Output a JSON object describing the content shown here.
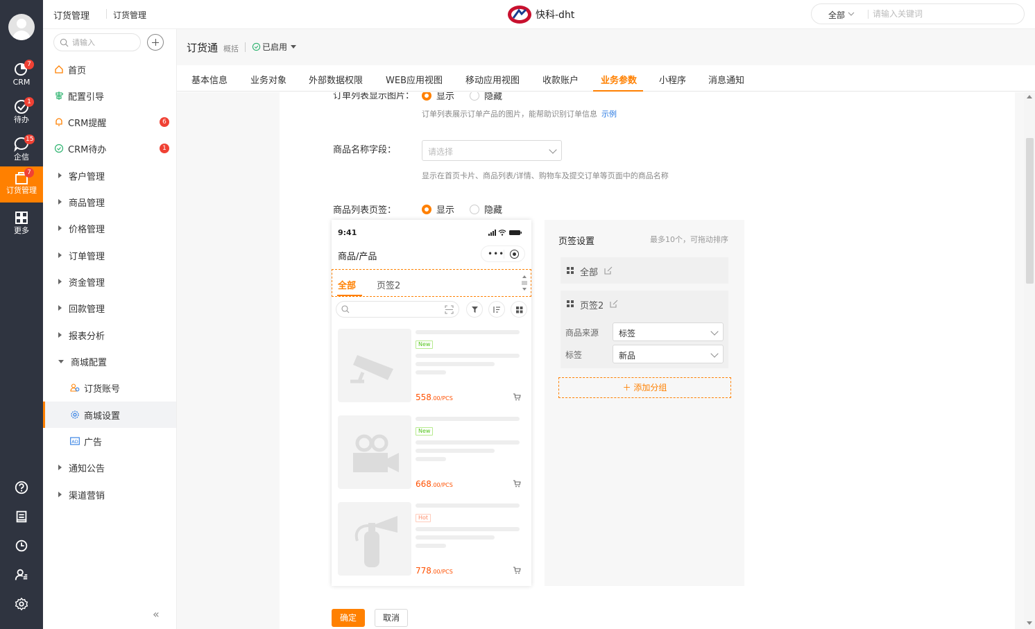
{
  "topbar": {
    "crumb_primary": "订货管理",
    "crumb_secondary": "订货管理",
    "brand_name": "快科-dht",
    "search_scope": "全部",
    "search_placeholder": "请输入关键词"
  },
  "rail": {
    "items": [
      {
        "label": "CRM",
        "badge": "7",
        "icon": "crm-icon"
      },
      {
        "label": "待办",
        "badge": "1",
        "icon": "todo-check-icon"
      },
      {
        "label": "企信",
        "badge": "15",
        "icon": "chat-bubble-icon"
      },
      {
        "label": "订货管理",
        "badge": "7",
        "icon": "order-bag-icon"
      },
      {
        "label": "更多",
        "badge": "",
        "icon": "grid-more-icon"
      }
    ],
    "bottom_icons": [
      "help-icon",
      "notepad-icon",
      "clock-icon",
      "contacts-icon",
      "settings-icon"
    ]
  },
  "sidenav": {
    "search_placeholder": "请输入",
    "items": [
      {
        "label": "首页",
        "type": "icon",
        "icon": "home-icon"
      },
      {
        "label": "配置引导",
        "type": "icon",
        "icon": "signpost-icon"
      },
      {
        "label": "CRM提醒",
        "type": "icon",
        "icon": "bell-icon",
        "badge": "6"
      },
      {
        "label": "CRM待办",
        "type": "icon",
        "icon": "check-circle-icon",
        "badge": "1"
      },
      {
        "label": "客户管理",
        "type": "group"
      },
      {
        "label": "商品管理",
        "type": "group"
      },
      {
        "label": "价格管理",
        "type": "group"
      },
      {
        "label": "订单管理",
        "type": "group"
      },
      {
        "label": "资金管理",
        "type": "group"
      },
      {
        "label": "回款管理",
        "type": "group"
      },
      {
        "label": "报表分析",
        "type": "group"
      },
      {
        "label": "商城配置",
        "type": "group-open"
      },
      {
        "label": "订货账号",
        "type": "sub",
        "icon": "users-icon"
      },
      {
        "label": "商城设置",
        "type": "sub",
        "icon": "gear-icon",
        "active": true
      },
      {
        "label": "广告",
        "type": "sub",
        "icon": "ad-icon"
      },
      {
        "label": "通知公告",
        "type": "group"
      },
      {
        "label": "渠道营销",
        "type": "group"
      }
    ],
    "collapse_label": "«"
  },
  "app": {
    "title": "订货通",
    "subtitle": "概括",
    "status": "已启用"
  },
  "tabs": [
    "基本信息",
    "业务对象",
    "外部数据权限",
    "WEB应用视图",
    "移动应用视图",
    "收款账户",
    "业务参数",
    "小程序",
    "消息通知"
  ],
  "active_tab": "业务参数",
  "form": {
    "order_image": {
      "label": "订单列表显示图片：",
      "show": "显示",
      "hide": "隐藏",
      "hint": "订单列表展示订单产品的图片，能帮助识别订单信息",
      "example": "示例"
    },
    "product_name_field": {
      "label": "商品名称字段：",
      "placeholder": "请选择",
      "hint": "显示在首页卡片、商品列表/详情、购物车及提交订单等页面中的商品名称"
    },
    "product_tabs": {
      "label": "商品列表页签：",
      "show": "显示",
      "hide": "隐藏"
    }
  },
  "phone": {
    "time": "9:41",
    "title": "商品/产品",
    "capsule_dots": "•••",
    "tabs": [
      "全部",
      "页签2"
    ],
    "products": [
      {
        "tag": "New",
        "tag_type": "new",
        "price": "558",
        "unit": ".00/PCS",
        "image_icon": "security-camera-icon"
      },
      {
        "tag": "New",
        "tag_type": "new",
        "price": "668",
        "unit": ".00/PCS",
        "image_icon": "video-camera-icon"
      },
      {
        "tag": "Hot",
        "tag_type": "hot",
        "price": "778",
        "unit": ".00/PCS",
        "image_icon": "fire-extinguisher-icon"
      }
    ]
  },
  "tab_settings": {
    "title": "页签设置",
    "note": "最多10个，可拖动排序",
    "rows": [
      {
        "label": "全部"
      },
      {
        "label": "页签2",
        "source_label": "商品来源",
        "source_value": "标签",
        "tag_label": "标签",
        "tag_value": "新品"
      }
    ],
    "add_group": "＋ 添加分组"
  },
  "actions": {
    "confirm": "确定",
    "cancel": "取消"
  },
  "colors": {
    "accent": "#ff8000",
    "rail": "#2f3440",
    "badge": "#f04134",
    "link": "#2a7ae2",
    "price": "#ff5000"
  }
}
